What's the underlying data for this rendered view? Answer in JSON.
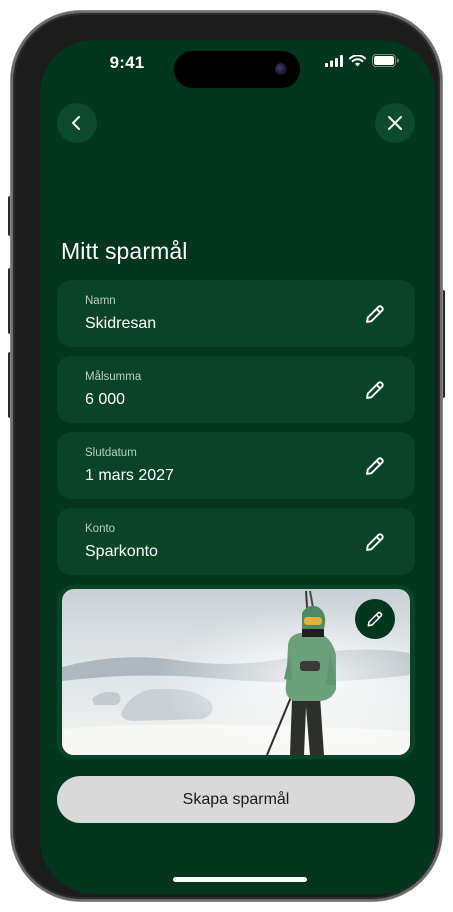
{
  "status_bar": {
    "time": "9:41"
  },
  "header": {
    "back_icon": "chevron-left-icon",
    "close_icon": "close-icon"
  },
  "page": {
    "title": "Mitt sparmål"
  },
  "fields": [
    {
      "label": "Namn",
      "value": "Skidresan"
    },
    {
      "label": "Målsumma",
      "value": "6 000"
    },
    {
      "label": "Slutdatum",
      "value": "1 mars 2027"
    },
    {
      "label": "Konto",
      "value": "Sparkonto"
    }
  ],
  "photo": {
    "edit_icon": "pencil-icon"
  },
  "actions": {
    "create_label": "Skapa sparmål"
  },
  "colors": {
    "background": "#02361e",
    "card": "#0a4428",
    "button": "#d9d9d9",
    "text": "#ffffff"
  }
}
